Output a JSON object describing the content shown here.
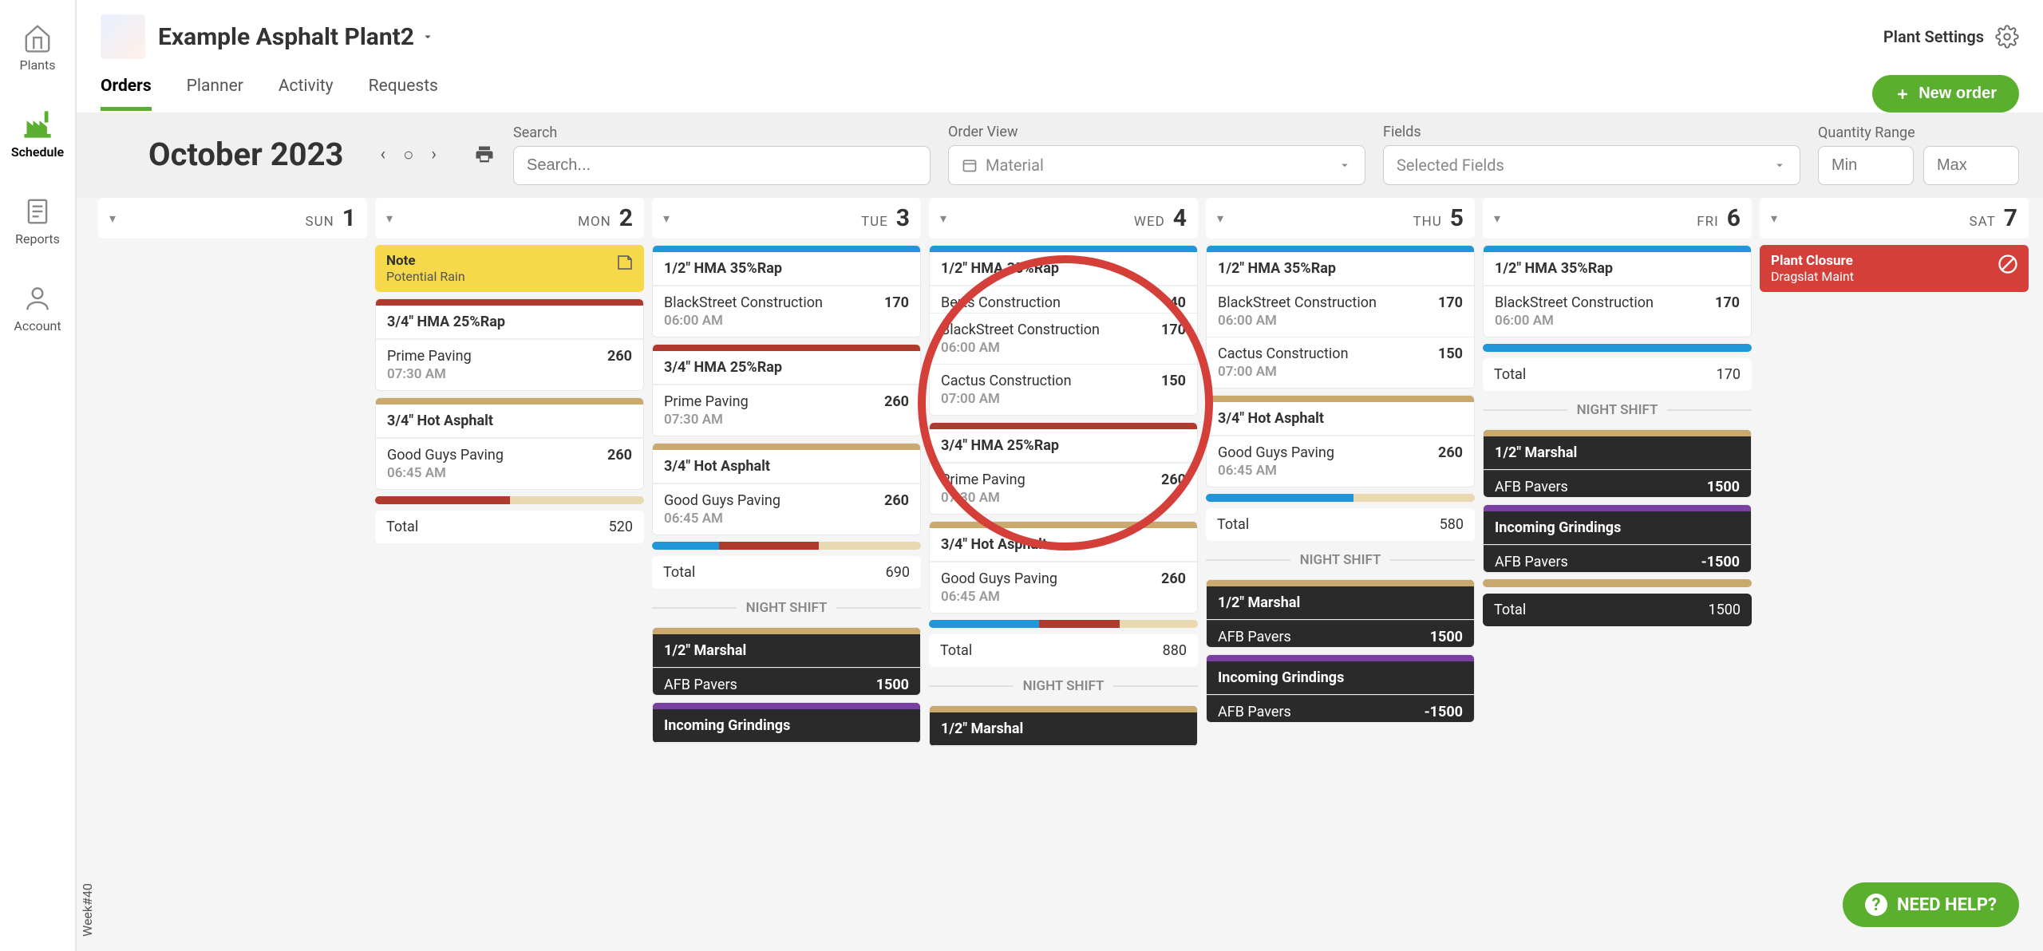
{
  "sidebar": {
    "items": [
      {
        "label": "Plants"
      },
      {
        "label": "Schedule"
      },
      {
        "label": "Reports"
      },
      {
        "label": "Account"
      }
    ]
  },
  "header": {
    "plant_name": "Example Asphalt Plant2",
    "plant_settings": "Plant Settings",
    "tabs": [
      {
        "label": "Orders"
      },
      {
        "label": "Planner"
      },
      {
        "label": "Activity"
      },
      {
        "label": "Requests"
      }
    ],
    "new_order": "New order"
  },
  "filters": {
    "month": "October 2023",
    "search_label": "Search",
    "search_placeholder": "Search...",
    "order_view_label": "Order View",
    "order_view_value": "Material",
    "fields_label": "Fields",
    "fields_value": "Selected Fields",
    "qty_label": "Quantity Range",
    "min_placeholder": "Min",
    "max_placeholder": "Max"
  },
  "week_label": "Week#40",
  "days": [
    {
      "name": "SUN",
      "num": "1"
    },
    {
      "name": "MON",
      "num": "2"
    },
    {
      "name": "TUE",
      "num": "3"
    },
    {
      "name": "WED",
      "num": "4"
    },
    {
      "name": "THU",
      "num": "5"
    },
    {
      "name": "FRI",
      "num": "6"
    },
    {
      "name": "SAT",
      "num": "7"
    }
  ],
  "mon": {
    "note_title": "Note",
    "note_sub": "Potential Rain",
    "card1_title": "3/4\" HMA 25%Rap",
    "card1_r1_name": "Prime Paving",
    "card1_r1_qty": "260",
    "card1_r1_time": "07:30 AM",
    "card2_title": "3/4\" Hot Asphalt",
    "card2_r1_name": "Good Guys Paving",
    "card2_r1_qty": "260",
    "card2_r1_time": "06:45 AM",
    "total_label": "Total",
    "total_val": "520"
  },
  "tue": {
    "card1_title": "1/2\" HMA 35%Rap",
    "card1_r1_name": "BlackStreet Construction",
    "card1_r1_qty": "170",
    "card1_r1_time": "06:00 AM",
    "card2_title": "3/4\" HMA 25%Rap",
    "card2_r1_name": "Prime Paving",
    "card2_r1_qty": "260",
    "card2_r1_time": "07:30 AM",
    "card3_title": "3/4\" Hot Asphalt",
    "card3_r1_name": "Good Guys Paving",
    "card3_r1_qty": "260",
    "card3_r1_time": "06:45 AM",
    "total_label": "Total",
    "total_val": "690",
    "night_label": "NIGHT SHIFT",
    "ns1_title": "1/2\" Marshal",
    "ns1_r1_name": "AFB Pavers",
    "ns1_r1_qty": "1500",
    "ns2_title": "Incoming Grindings"
  },
  "wed": {
    "card1_title": "1/2\" HMA 35%Rap",
    "card1_r1_name": "Berts Construction",
    "card1_r1_qty": "40",
    "card1_r2_name": "BlackStreet Construction",
    "card1_r2_qty": "170",
    "card1_r2_time": "06:00 AM",
    "card1_r3_name": "Cactus Construction",
    "card1_r3_qty": "150",
    "card1_r3_time": "07:00 AM",
    "card2_title": "3/4\" HMA 25%Rap",
    "card2_r1_name": "Prime Paving",
    "card2_r1_qty": "260",
    "card2_r1_time": "07:30 AM",
    "card3_title": "3/4\" Hot Asphalt",
    "card3_r1_name": "Good Guys Paving",
    "card3_r1_qty": "260",
    "card3_r1_time": "06:45 AM",
    "total_label": "Total",
    "total_val": "880",
    "night_label": "NIGHT SHIFT",
    "ns1_title": "1/2\" Marshal"
  },
  "thu": {
    "card1_title": "1/2\" HMA 35%Rap",
    "card1_r1_name": "BlackStreet Construction",
    "card1_r1_qty": "170",
    "card1_r1_time": "06:00 AM",
    "card1_r2_name": "Cactus Construction",
    "card1_r2_qty": "150",
    "card1_r2_time": "07:00 AM",
    "card2_title": "3/4\" Hot Asphalt",
    "card2_r1_name": "Good Guys Paving",
    "card2_r1_qty": "260",
    "card2_r1_time": "06:45 AM",
    "total_label": "Total",
    "total_val": "580",
    "night_label": "NIGHT SHIFT",
    "ns1_title": "1/2\" Marshal",
    "ns1_r1_name": "AFB Pavers",
    "ns1_r1_qty": "1500",
    "ns2_title": "Incoming Grindings",
    "ns2_r1_name": "AFB Pavers",
    "ns2_r1_qty": "-1500"
  },
  "fri": {
    "card1_title": "1/2\" HMA 35%Rap",
    "card1_r1_name": "BlackStreet Construction",
    "card1_r1_qty": "170",
    "card1_r1_time": "06:00 AM",
    "total_label": "Total",
    "total_val": "170",
    "night_label": "NIGHT SHIFT",
    "ns1_title": "1/2\" Marshal",
    "ns1_r1_name": "AFB Pavers",
    "ns1_r1_qty": "1500",
    "ns2_title": "Incoming Grindings",
    "ns2_r1_name": "AFB Pavers",
    "ns2_r1_qty": "-1500",
    "ns_total_label": "Total",
    "ns_total_val": "1500"
  },
  "sat": {
    "closure_title": "Plant Closure",
    "closure_sub": "Dragslat Maint"
  },
  "help_label": "NEED HELP?"
}
